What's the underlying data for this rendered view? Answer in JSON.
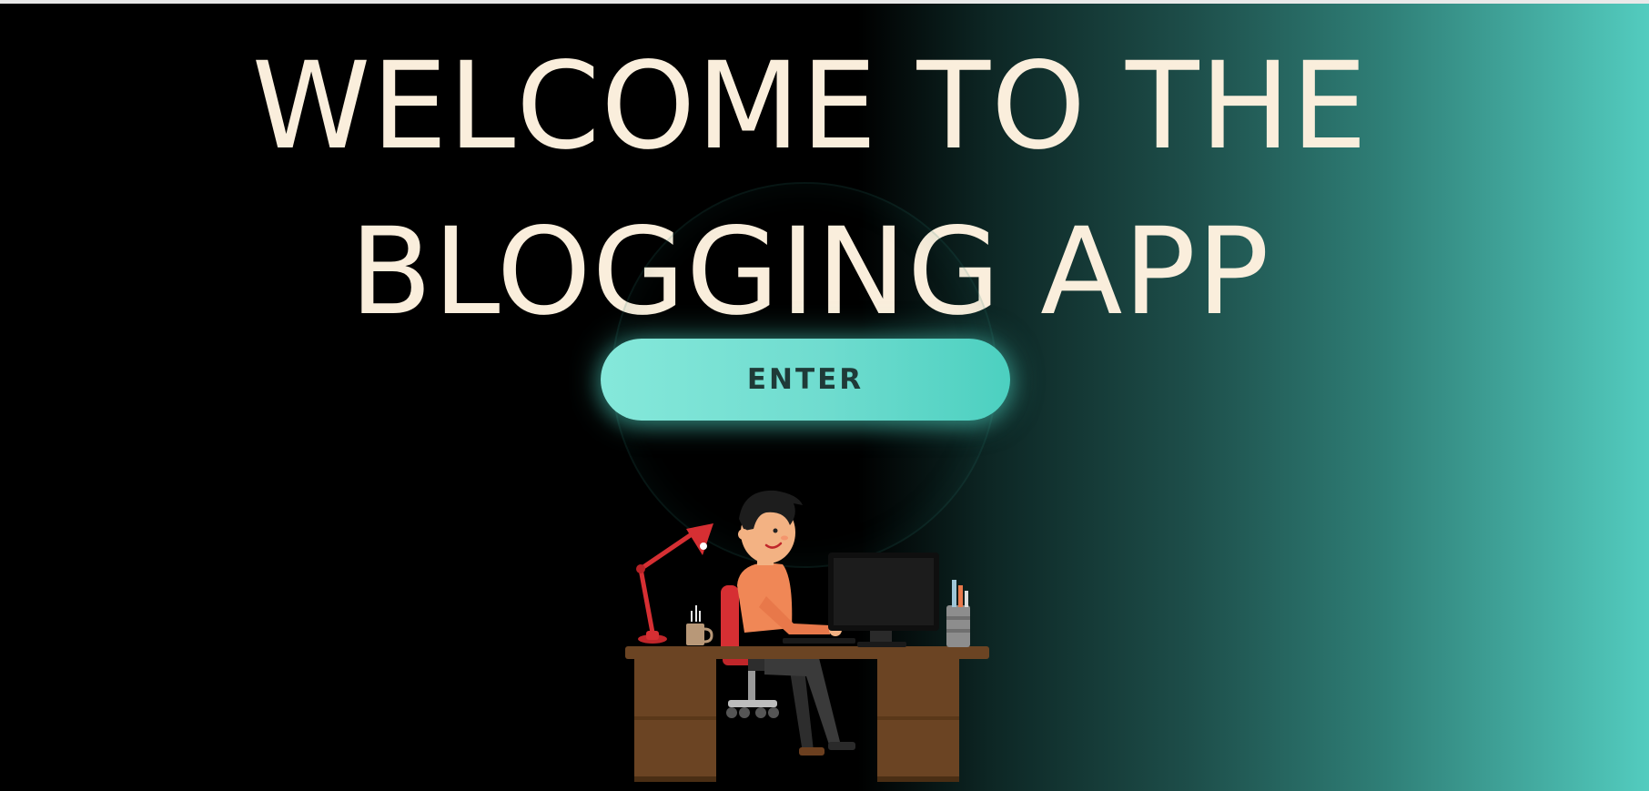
{
  "hero": {
    "title_line1": "WELCOME TO THE",
    "title_line2": "BLOGGING APP",
    "enter_label": "ENTER"
  },
  "colors": {
    "title": "#faeedc",
    "button": "#6fdccf",
    "button_text": "#1f3a38",
    "gradient_end": "#53ccbf"
  },
  "icons": {
    "illustration": "person-at-desk-illustration"
  }
}
